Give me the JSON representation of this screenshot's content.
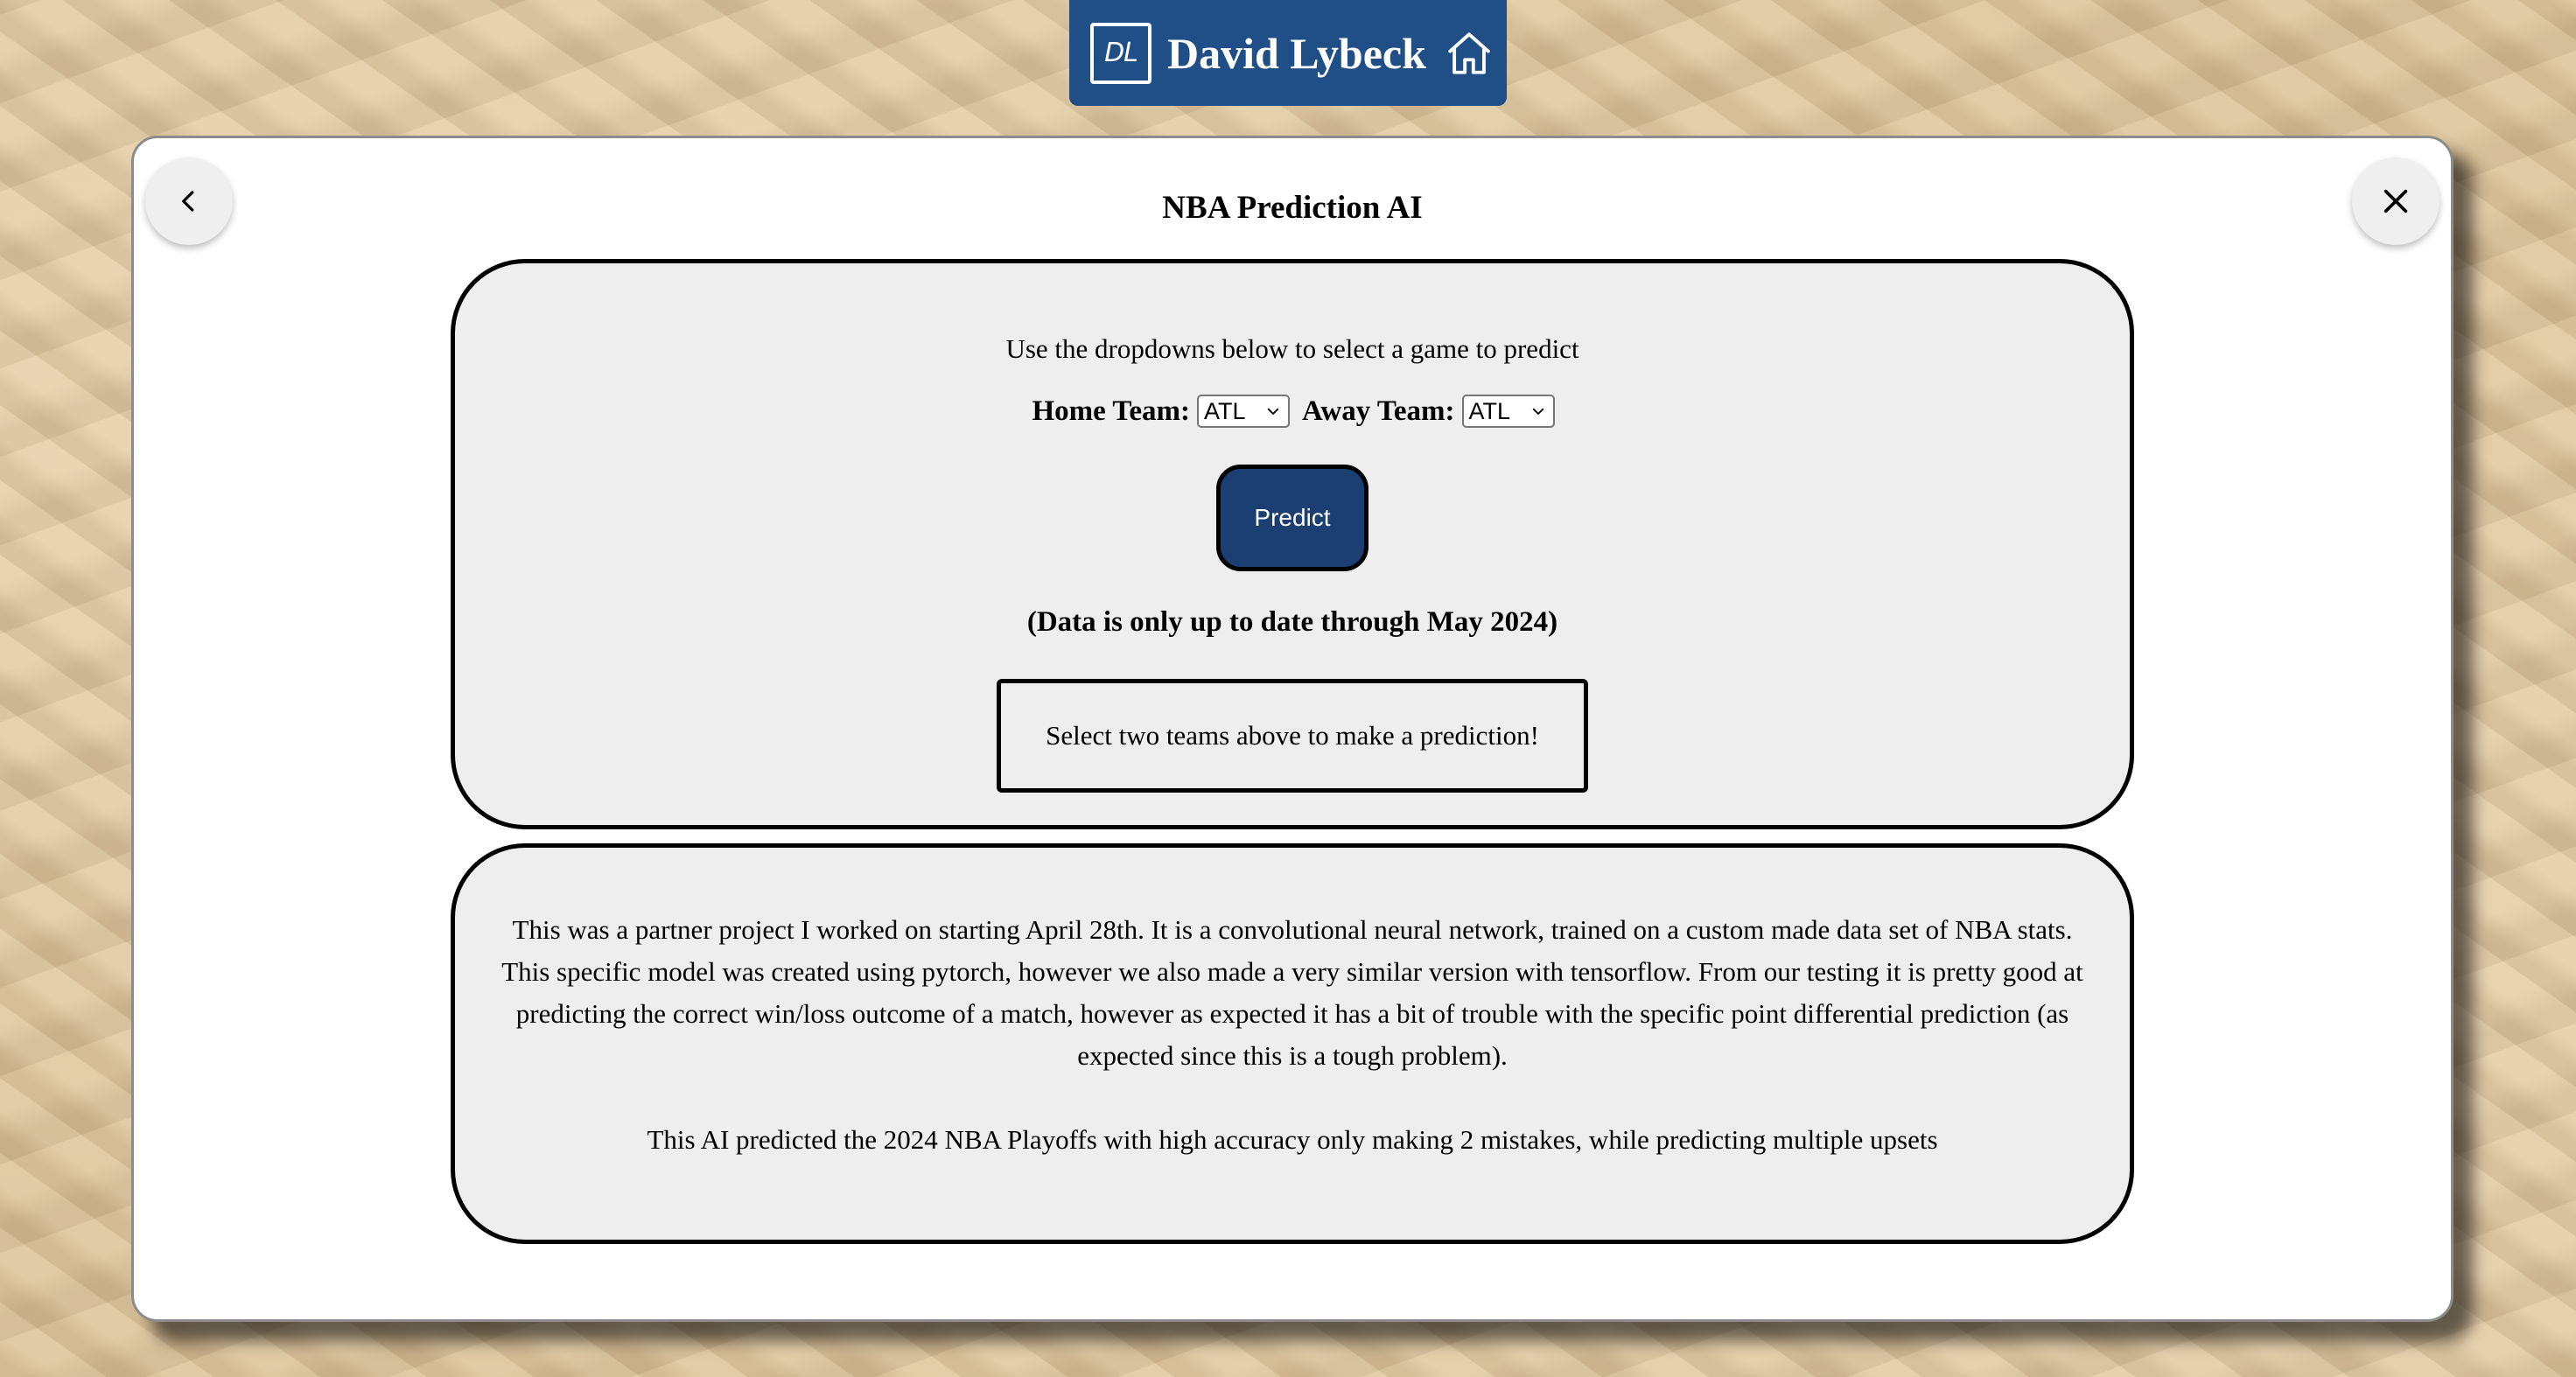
{
  "header": {
    "logo_text": "DL",
    "name": "David Lybeck",
    "home_icon": "home-icon"
  },
  "modal": {
    "title": "NBA Prediction AI",
    "back_icon": "chevron-left-icon",
    "close_icon": "close-icon"
  },
  "predictor": {
    "instructions": "Use the dropdowns below to select a game to predict",
    "home_label": "Home Team:",
    "home_value": "ATL",
    "away_label": "Away Team:",
    "away_value": "ATL",
    "predict_label": "Predict",
    "note": "(Data is only up to date through May 2024)",
    "result": "Select two teams above to make a prediction!"
  },
  "description": {
    "paragraph_1": "This was a partner project I worked on starting April 28th. It is a convolutional neural network, trained on a custom made data set of NBA stats. This specific model was created using pytorch, however we also made a very similar version with tensorflow. From our testing it is pretty good at predicting the correct win/loss outcome of a match, however as expected it has a bit of trouble with the specific point differential prediction (as expected since this is a tough problem).",
    "paragraph_2": "This AI predicted the 2024 NBA Playoffs with high accuracy only making 2 mistakes, while predicting multiple upsets"
  },
  "colors": {
    "brand": "#1f4f86",
    "predict_button": "#1b3f72",
    "card_background": "#eeeeee"
  }
}
